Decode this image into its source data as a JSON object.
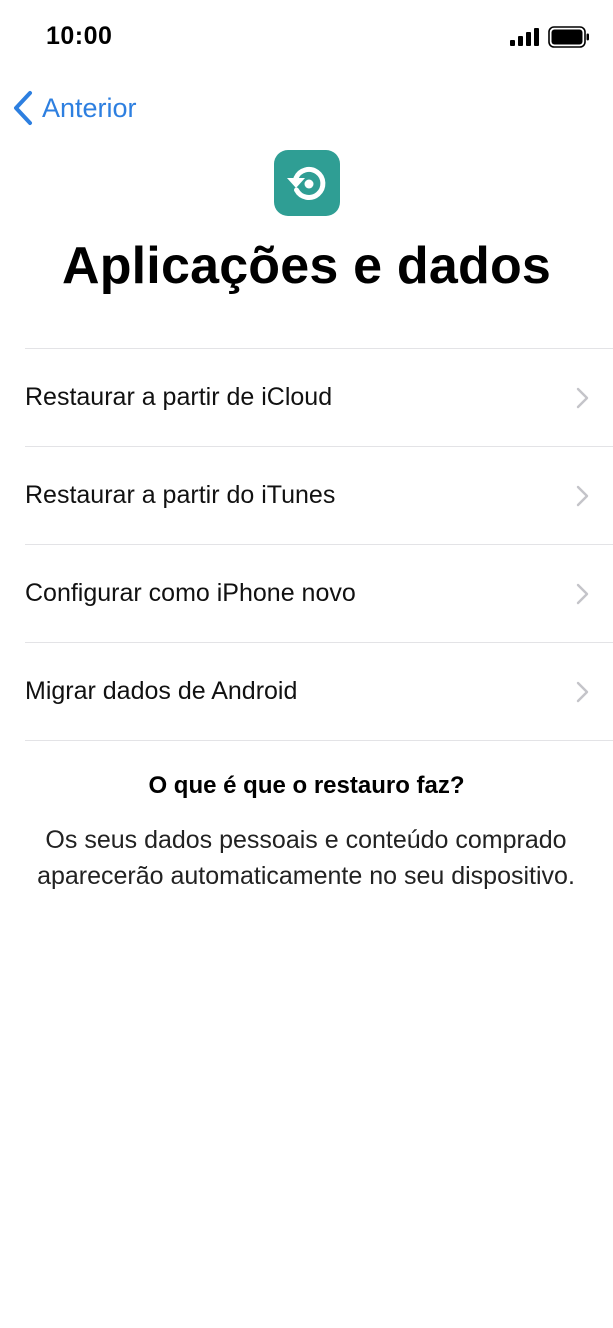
{
  "status_bar": {
    "time": "10:00",
    "signal_icon": "signal-bars-icon",
    "battery_icon": "battery-full-icon"
  },
  "nav": {
    "back_label": "Anterior",
    "back_icon": "chevron-left-icon"
  },
  "colors": {
    "accent": "#2d7fe0",
    "app_icon_bg": "#2f9e94",
    "separator": "#e3e3e6",
    "chevron": "#c4c4c9"
  },
  "header": {
    "icon": "restore-icon",
    "title": "Aplicações e dados"
  },
  "options": [
    {
      "label": "Restaurar a partir de iCloud"
    },
    {
      "label": "Restaurar a partir do iTunes"
    },
    {
      "label": "Configurar como iPhone novo"
    },
    {
      "label": "Migrar dados de Android"
    }
  ],
  "info": {
    "heading": "O que é que o restauro faz?",
    "body": "Os seus dados pessoais e conteúdo comprado aparecerão automaticamente no seu dispositivo."
  }
}
